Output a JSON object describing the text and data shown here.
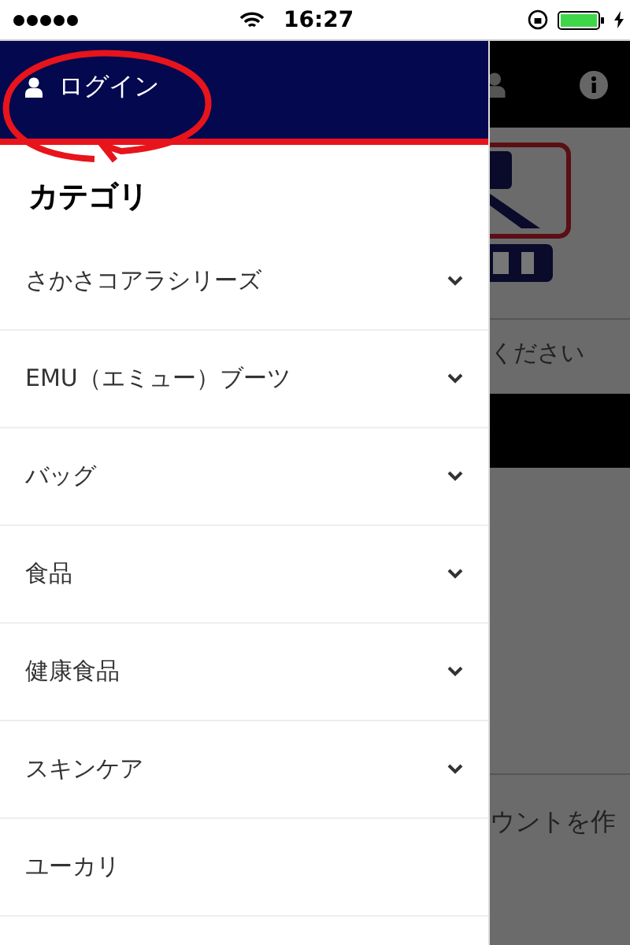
{
  "status_bar": {
    "time": "16:27"
  },
  "drawer": {
    "login": "ログイン",
    "heading": "カテゴリ",
    "items": [
      {
        "label": "さかさコアラシリーズ",
        "expandable": true
      },
      {
        "label": "EMU（エミュー）ブーツ",
        "expandable": true
      },
      {
        "label": "バッグ",
        "expandable": true
      },
      {
        "label": "食品",
        "expandable": true
      },
      {
        "label": "健康食品",
        "expandable": true
      },
      {
        "label": "スキンケア",
        "expandable": true
      },
      {
        "label": "ユーカリ",
        "expandable": false
      }
    ]
  },
  "background_page": {
    "texts": [
      "ください",
      "ウントを作"
    ]
  }
}
